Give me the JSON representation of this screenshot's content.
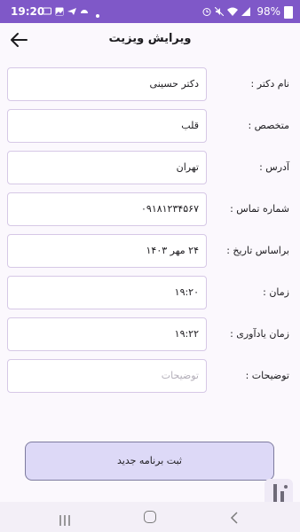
{
  "status_bar": {
    "time": "19:20",
    "battery": "98%"
  },
  "header": {
    "title": "ویرایش ویزیت"
  },
  "form": {
    "fields": [
      {
        "label": "نام دکتر :",
        "value": "دکتر حسینی",
        "placeholder": ""
      },
      {
        "label": "متخصص :",
        "value": "قلب",
        "placeholder": ""
      },
      {
        "label": "آدرس :",
        "value": "تهران",
        "placeholder": ""
      },
      {
        "label": "شماره تماس :",
        "value": "۰۹۱۸۱۲۳۴۵۶۷",
        "placeholder": ""
      },
      {
        "label": "براساس تاریخ :",
        "value": "۲۴  مهر  ۱۴۰۳",
        "placeholder": ""
      },
      {
        "label": "زمان :",
        "value": "۱۹:۲۰",
        "placeholder": ""
      },
      {
        "label": "زمان یادآوری :",
        "value": "۱۹:۲۲",
        "placeholder": ""
      },
      {
        "label": "توضیحات :",
        "value": "",
        "placeholder": "توضیحات"
      }
    ],
    "submit_label": "ثبت برنامه جدید"
  },
  "colors": {
    "status_bar_bg": "#7f58c8",
    "button_bg": "#ddd9f7",
    "field_border": "#d6c8e6"
  },
  "icons": {
    "back": "arrow-left-icon",
    "nav_recents": "recents-icon",
    "nav_home": "home-icon",
    "nav_back": "chevron-left-icon"
  }
}
